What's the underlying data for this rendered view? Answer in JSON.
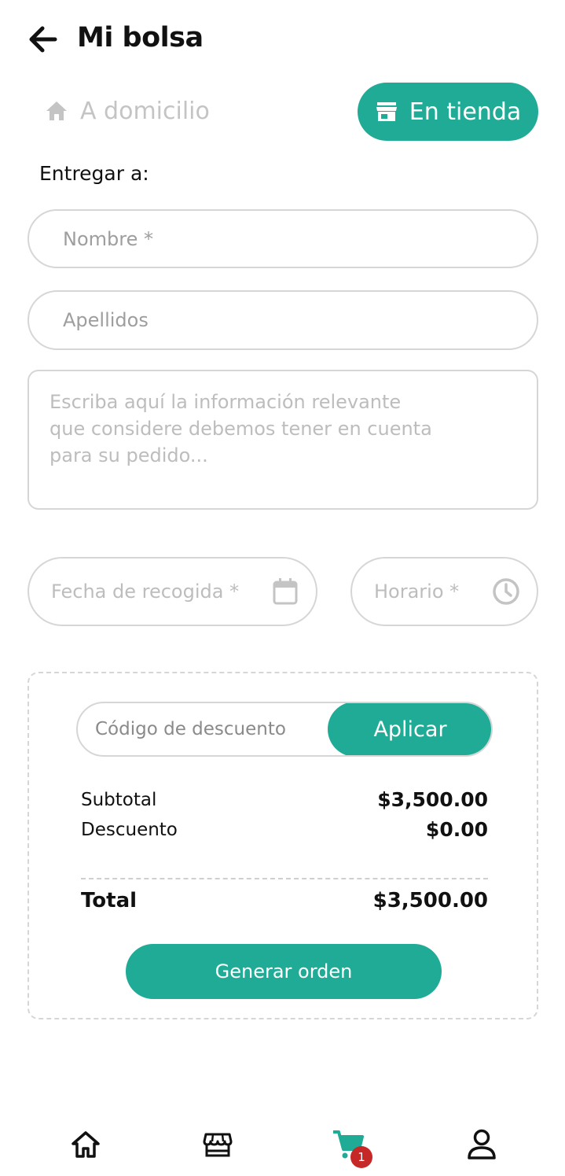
{
  "header": {
    "title": "Mi bolsa"
  },
  "delivery_mode": {
    "home_label": "A domicilio",
    "store_label": "En tienda",
    "selected": "En tienda"
  },
  "form": {
    "deliver_to_label": "Entregar a:",
    "first_name_placeholder": "Nombre *",
    "last_name_placeholder": "Apellidos",
    "notes_placeholder": "Escriba aquí la información relevante\nque considere debemos tener en cuenta\npara su pedido...",
    "pickup_date_placeholder": "Fecha de recogida *",
    "pickup_time_placeholder": "Horario *"
  },
  "summary": {
    "coupon_placeholder": "Código de descuento",
    "apply_label": "Aplicar",
    "subtotal_label": "Subtotal",
    "subtotal_value": "$3,500.00",
    "discount_label": "Descuento",
    "discount_value": "$0.00",
    "total_label": "Total",
    "total_value": "$3,500.00",
    "generate_order_label": "Generar orden"
  },
  "bottom_nav": {
    "items": [
      {
        "icon": "home-icon"
      },
      {
        "icon": "store-icon"
      },
      {
        "icon": "cart-icon",
        "active": true
      },
      {
        "icon": "profile-icon"
      }
    ],
    "cart_badge": "1"
  },
  "colors": {
    "accent": "#1fab96",
    "badge": "#c62828",
    "inactive_text": "#c4c4c4",
    "border": "#d6d6d6"
  }
}
